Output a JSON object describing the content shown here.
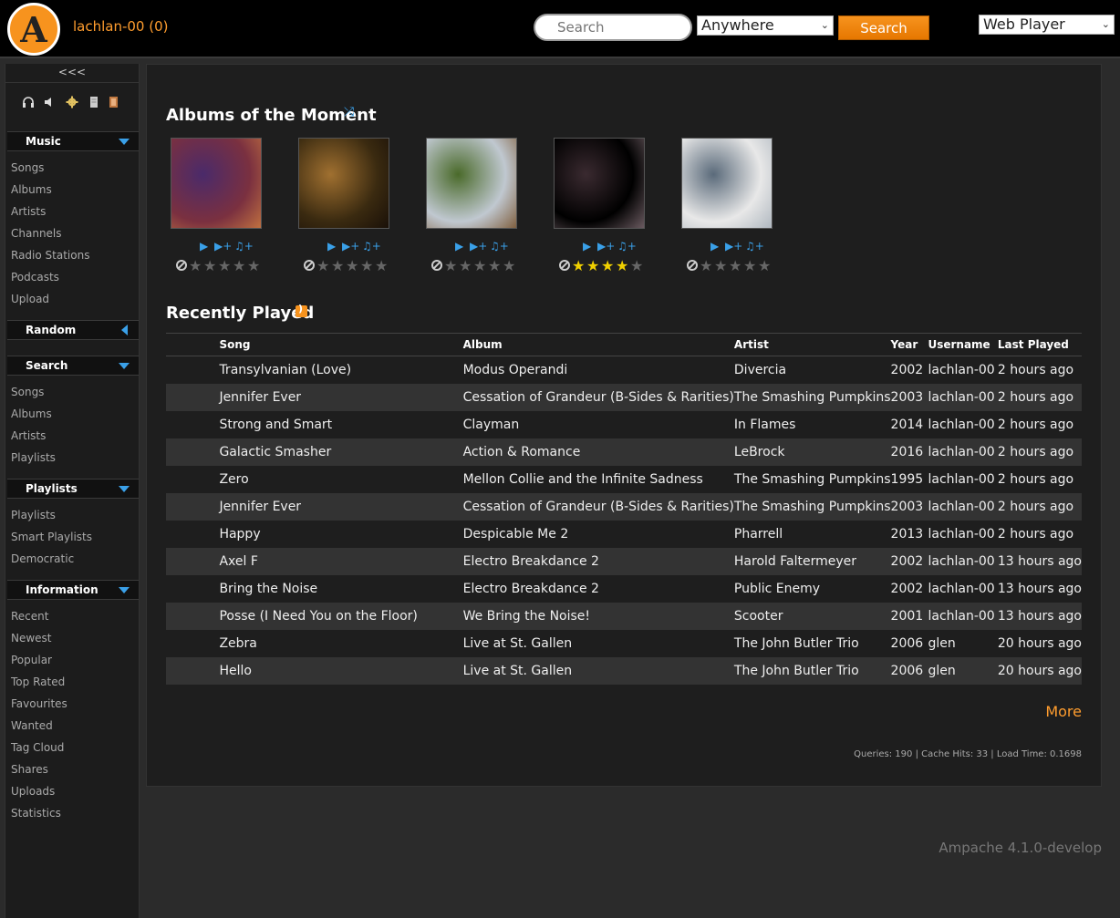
{
  "header": {
    "logo_letter": "A",
    "user": "lachlan-00 (0)",
    "search_placeholder": "Search",
    "scope": "Anywhere",
    "search_button": "Search",
    "player": "Web Player"
  },
  "sidebar": {
    "collapse": "<<<",
    "icons": [
      "headphones-icon",
      "speaker-icon",
      "gear-icon",
      "document-icon",
      "logout-icon"
    ],
    "music": {
      "title": "Music",
      "items": [
        "Songs",
        "Albums",
        "Artists",
        "Channels",
        "Radio Stations",
        "Podcasts",
        "Upload"
      ]
    },
    "random": {
      "title": "Random"
    },
    "search": {
      "title": "Search",
      "items": [
        "Songs",
        "Albums",
        "Artists",
        "Playlists"
      ]
    },
    "playlists": {
      "title": "Playlists",
      "items": [
        "Playlists",
        "Smart Playlists",
        "Democratic"
      ]
    },
    "information": {
      "title": "Information",
      "items": [
        "Recent",
        "Newest",
        "Popular",
        "Top Rated",
        "Favourites",
        "Wanted",
        "Tag Cloud",
        "Shares",
        "Uploads",
        "Statistics"
      ]
    }
  },
  "albums_title": "Albums of the Moment",
  "albums": [
    {
      "rating": 0,
      "colors": [
        "#7a3040",
        "#4a2a6a",
        "#c07040"
      ]
    },
    {
      "rating": 0,
      "colors": [
        "#3a2a10",
        "#a07030",
        "#1a1008"
      ]
    },
    {
      "rating": 0,
      "colors": [
        "#c0c8d0",
        "#4a6a2a",
        "#806040"
      ]
    },
    {
      "rating": 4,
      "colors": [
        "#000000",
        "#3a2a30",
        "#6a5a60"
      ]
    },
    {
      "rating": 0,
      "colors": [
        "#e8e8e8",
        "#5a6a7a",
        "#b0b8c0"
      ]
    }
  ],
  "recent_title": "Recently Played",
  "table": {
    "headers": [
      "Song",
      "Album",
      "Artist",
      "Year",
      "Username",
      "Last Played"
    ],
    "rows": [
      [
        "Transylvanian (Love)",
        "Modus Operandi",
        "Divercia",
        "2002",
        "lachlan-00",
        "2 hours ago"
      ],
      [
        "Jennifer Ever",
        "Cessation of Grandeur (B-Sides & Rarities)",
        "The Smashing Pumpkins",
        "2003",
        "lachlan-00",
        "2 hours ago"
      ],
      [
        "Strong and Smart",
        "Clayman",
        "In Flames",
        "2014",
        "lachlan-00",
        "2 hours ago"
      ],
      [
        "Galactic Smasher",
        "Action & Romance",
        "LeBrock",
        "2016",
        "lachlan-00",
        "2 hours ago"
      ],
      [
        "Zero",
        "Mellon Collie and the Infinite Sadness",
        "The Smashing Pumpkins",
        "1995",
        "lachlan-00",
        "2 hours ago"
      ],
      [
        "Jennifer Ever",
        "Cessation of Grandeur (B-Sides & Rarities)",
        "The Smashing Pumpkins",
        "2003",
        "lachlan-00",
        "2 hours ago"
      ],
      [
        "Happy",
        "Despicable Me 2",
        "Pharrell",
        "2013",
        "lachlan-00",
        "2 hours ago"
      ],
      [
        "Axel F",
        "Electro Breakdance 2",
        "Harold Faltermeyer",
        "2002",
        "lachlan-00",
        "13 hours ago"
      ],
      [
        "Bring the Noise",
        "Electro Breakdance 2",
        "Public Enemy",
        "2002",
        "lachlan-00",
        "13 hours ago"
      ],
      [
        "Posse (I Need You on the Floor)",
        "We Bring the Noise!",
        "Scooter",
        "2001",
        "lachlan-00",
        "13 hours ago"
      ],
      [
        "Zebra",
        "Live at St. Gallen",
        "The John Butler Trio",
        "2006",
        "glen",
        "20 hours ago"
      ],
      [
        "Hello",
        "Live at St. Gallen",
        "The John Butler Trio",
        "2006",
        "glen",
        "20 hours ago"
      ]
    ]
  },
  "more": "More",
  "stats": "Queries: 190 | Cache Hits: 33 | Load Time: 0.1698",
  "version": "Ampache 4.1.0-develop",
  "colors": {
    "accent": "#f7931e",
    "link": "#ff9d2e",
    "icon_blue": "#3aa0e8"
  }
}
